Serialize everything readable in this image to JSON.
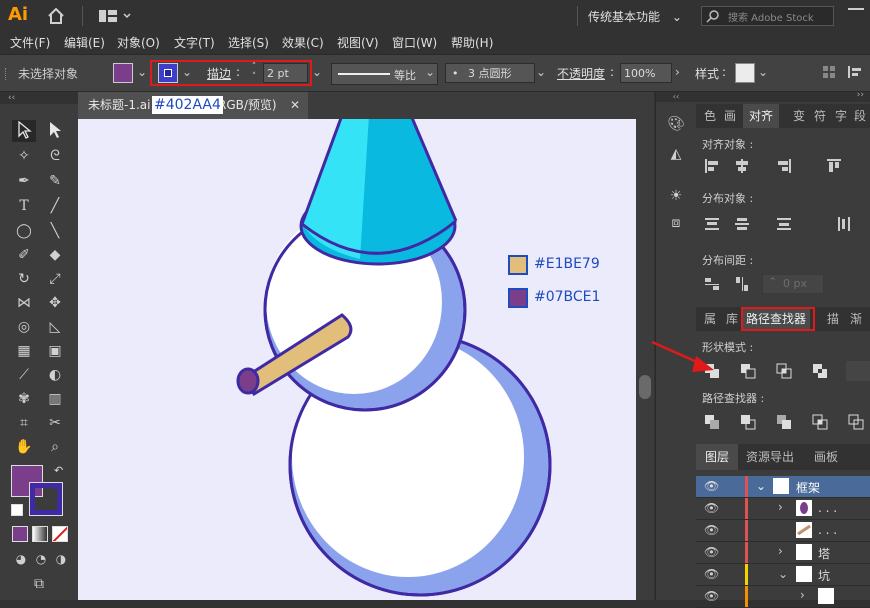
{
  "app": {
    "logo": "Ai",
    "workspace": "传统基本功能",
    "search_placeholder": "搜索 Adobe Stock"
  },
  "menu": [
    "文件(F)",
    "编辑(E)",
    "对象(O)",
    "文字(T)",
    "选择(S)",
    "效果(C)",
    "视图(V)",
    "窗口(W)",
    "帮助(H)"
  ],
  "control": {
    "no_selection": "未选择对象",
    "stroke_label": "描边",
    "stroke_colon": ":",
    "stroke_value": "2 pt",
    "profile_label": "等比",
    "brush_label": "3 点圆形",
    "opacity_label": "不透明度",
    "opacity_colon": ":",
    "opacity_value": "100%",
    "style_label": "样式",
    "style_colon": ":"
  },
  "document": {
    "tab_title": "未标题-1.ai",
    "tab_suffix": "RGB/预览)",
    "overlay_color_label": "#402AA4"
  },
  "artwork": {
    "swatches": [
      {
        "label": "#E1BE79",
        "color": "#e1be79"
      },
      {
        "label": "#07BCE1",
        "color": "#7b3e8a"
      }
    ]
  },
  "colors": {
    "fill": "#7b3e8a",
    "stroke": "#402aa4",
    "accent_red": "#e01a1a",
    "artboard": "#ecebfb"
  },
  "panels": {
    "top_tabs": [
      "色",
      "画",
      "对齐",
      "变",
      "符",
      "字",
      "段"
    ],
    "active_top_tab": "对齐",
    "align_objects": "对齐对象 :",
    "distribute_objects": "分布对象 :",
    "distribute_spacing": "分布间距 :",
    "spacing_value": "0 px",
    "mid_tabs": [
      "属",
      "库",
      "路径查找器",
      "描",
      "渐"
    ],
    "active_mid_tab": "路径查找器",
    "shape_modes": "形状模式 :",
    "pathfinders": "路径查找器 :",
    "layers_tabs": [
      "图层",
      "资源导出",
      "画板"
    ],
    "layers": [
      {
        "name": "框架"
      },
      {
        "name": ". . ."
      },
      {
        "name": ". . ."
      },
      {
        "name": "塔"
      },
      {
        "name": "坑"
      },
      {
        "name": ""
      }
    ]
  }
}
